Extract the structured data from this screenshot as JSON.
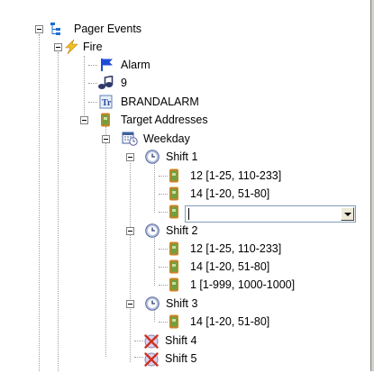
{
  "tree": {
    "root": "Pager Events",
    "fire": "Fire",
    "alarm": "Alarm",
    "number": "9",
    "text": "BRANDALARM",
    "target_addresses": "Target Addresses",
    "weekday": "Weekday",
    "shift1": {
      "label": "Shift 1",
      "items": [
        "12 [1-25, 110-233]",
        "14 [1-20, 51-80]"
      ],
      "combo_value": ""
    },
    "shift2": {
      "label": "Shift 2",
      "items": [
        "12 [1-25, 110-233]",
        "14 [1-20, 51-80]",
        "1 [1-999, 1000-1000]"
      ]
    },
    "shift3": {
      "label": "Shift 3",
      "items": [
        "14 [1-20, 51-80]"
      ]
    },
    "shift4": "Shift 4",
    "shift5": "Shift 5"
  },
  "icons": {
    "root": "tree-icon",
    "fire": "lightning-icon",
    "alarm": "flag-icon",
    "number": "note-icon",
    "text": "text-icon",
    "pager": "pager-icon",
    "weekday": "calendar-clock-icon",
    "shift": "clock-icon",
    "shift_disabled": "disabled-shift-icon"
  },
  "colors": {
    "background": "#ffffff",
    "pager_green": "#6fa040",
    "pager_orange": "#d08020",
    "flag_blue": "#1e4bd6",
    "lightning": "#f0c020",
    "disabled_red": "#d03020"
  }
}
